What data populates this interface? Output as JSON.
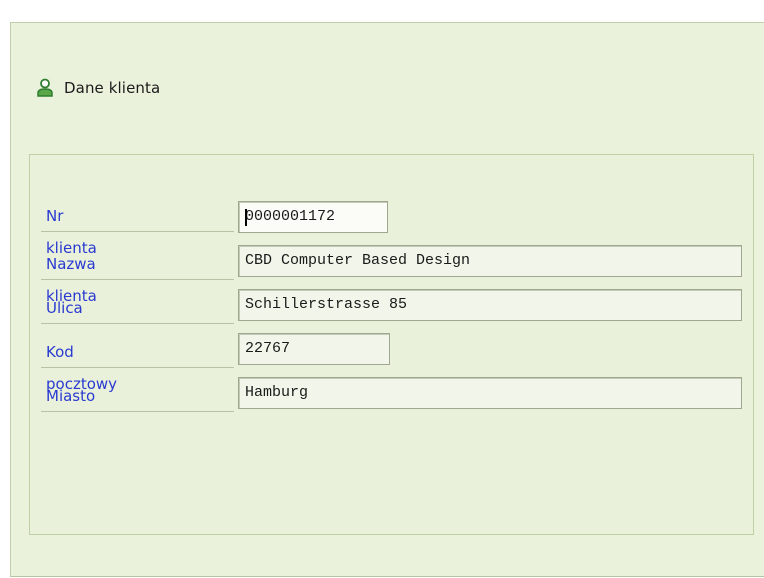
{
  "header": {
    "title": "Dane klienta",
    "icon": "user-icon",
    "icon_color": "#3a8d3a"
  },
  "form": {
    "fields": [
      {
        "label": "Nr klienta",
        "value": "0000001172",
        "focused": true
      },
      {
        "label": "Nazwa klienta",
        "value": "CBD Computer Based Design"
      },
      {
        "label": "Ulica",
        "value": "Schillerstrasse 85"
      },
      {
        "label": "Kod pocztowy",
        "value": "22767"
      },
      {
        "label": "Miasto",
        "value": "Hamburg"
      }
    ]
  },
  "colors": {
    "label": "#2a3ad0",
    "panel_background": "#ebf2dc",
    "focus_marker": "#c7372b"
  }
}
